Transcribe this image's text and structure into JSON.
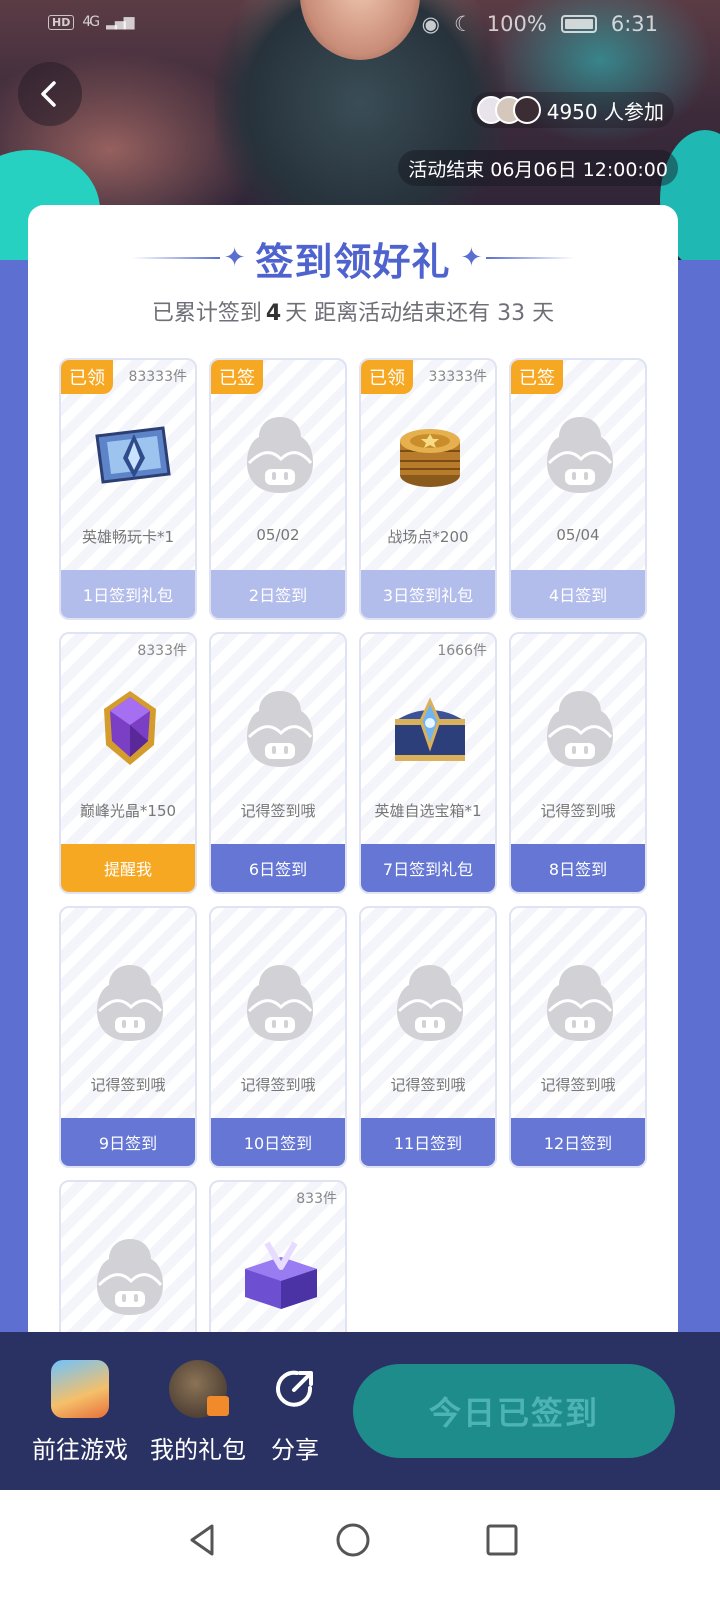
{
  "status_bar": {
    "hd": "HD",
    "signal": "4G",
    "battery": "100%",
    "time": "6:31"
  },
  "header": {
    "participants_text": "4950 人参加",
    "end_time_text": "活动结束 06月06日 12:00:00"
  },
  "checkin": {
    "title": "签到领好礼",
    "subtitle_prefix": "已累计签到",
    "days_signed": "4",
    "subtitle_mid": "天  距离活动结束还有 33 天",
    "tiles": [
      {
        "badge": "已领",
        "count": "83333件",
        "name": "英雄畅玩卡*1",
        "footer": "1日签到礼包",
        "icon": "hero-card-icon",
        "done": true
      },
      {
        "badge": "已签",
        "count": "",
        "name": "05/02",
        "footer": "2日签到",
        "icon": "placeholder-mascot-icon",
        "done": true
      },
      {
        "badge": "已领",
        "count": "33333件",
        "name": "战场点*200",
        "footer": "3日签到礼包",
        "icon": "coin-stack-icon",
        "done": true
      },
      {
        "badge": "已签",
        "count": "",
        "name": "05/04",
        "footer": "4日签到",
        "icon": "placeholder-mascot-icon",
        "done": true
      },
      {
        "badge": "",
        "count": "8333件",
        "name": "巅峰光晶*150",
        "footer": "提醒我",
        "icon": "purple-crystal-icon",
        "done": false,
        "footer_color": "orange"
      },
      {
        "badge": "",
        "count": "",
        "name": "记得签到哦",
        "footer": "6日签到",
        "icon": "placeholder-mascot-icon",
        "done": false
      },
      {
        "badge": "",
        "count": "1666件",
        "name": "英雄自选宝箱*1",
        "footer": "7日签到礼包",
        "icon": "treasure-chest-icon",
        "done": false
      },
      {
        "badge": "",
        "count": "",
        "name": "记得签到哦",
        "footer": "8日签到",
        "icon": "placeholder-mascot-icon",
        "done": false
      },
      {
        "badge": "",
        "count": "",
        "name": "记得签到哦",
        "footer": "9日签到",
        "icon": "placeholder-mascot-icon",
        "done": false
      },
      {
        "badge": "",
        "count": "",
        "name": "记得签到哦",
        "footer": "10日签到",
        "icon": "placeholder-mascot-icon",
        "done": false
      },
      {
        "badge": "",
        "count": "",
        "name": "记得签到哦",
        "footer": "11日签到",
        "icon": "placeholder-mascot-icon",
        "done": false
      },
      {
        "badge": "",
        "count": "",
        "name": "记得签到哦",
        "footer": "12日签到",
        "icon": "placeholder-mascot-icon",
        "done": false
      },
      {
        "badge": "",
        "count": "",
        "name": "",
        "footer": "",
        "icon": "placeholder-mascot-icon",
        "done": false
      },
      {
        "badge": "",
        "count": "833件",
        "name": "",
        "footer": "",
        "icon": "purple-chest-icon",
        "done": false
      }
    ]
  },
  "bottom_bar": {
    "game_label": "前往游戏",
    "gift_label": "我的礼包",
    "share_label": "分享",
    "signed_button": "今日已签到"
  },
  "colors": {
    "accent": "#4f63cf",
    "badge": "#f7a823",
    "tile_footer": "#6576d4",
    "tile_footer_done": "#b3bdeb",
    "bottom_bar": "#2a3163",
    "signed_button": "#1f8c8c"
  }
}
